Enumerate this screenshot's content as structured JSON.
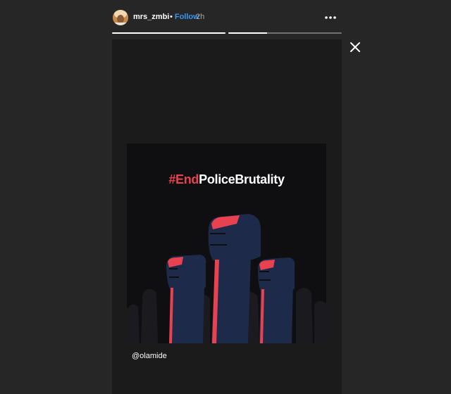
{
  "header": {
    "username": "mrs_zmbi",
    "separator": "•",
    "follow_label": "Follow",
    "time_ago": "2h",
    "more_icon": "more-horizontal-icon"
  },
  "progress": {
    "segments": [
      {
        "state": "complete",
        "fill": 1.0
      },
      {
        "state": "active",
        "fill": 0.34
      }
    ]
  },
  "close_icon": "close-icon",
  "story": {
    "poster_title_accent": "#End",
    "poster_title_rest": "PoliceBrutality",
    "mention": "@olamide"
  },
  "colors": {
    "accent_red": "#e8414f",
    "follow_blue": "#3897f0",
    "fist_navy": "#1e2a4a"
  }
}
